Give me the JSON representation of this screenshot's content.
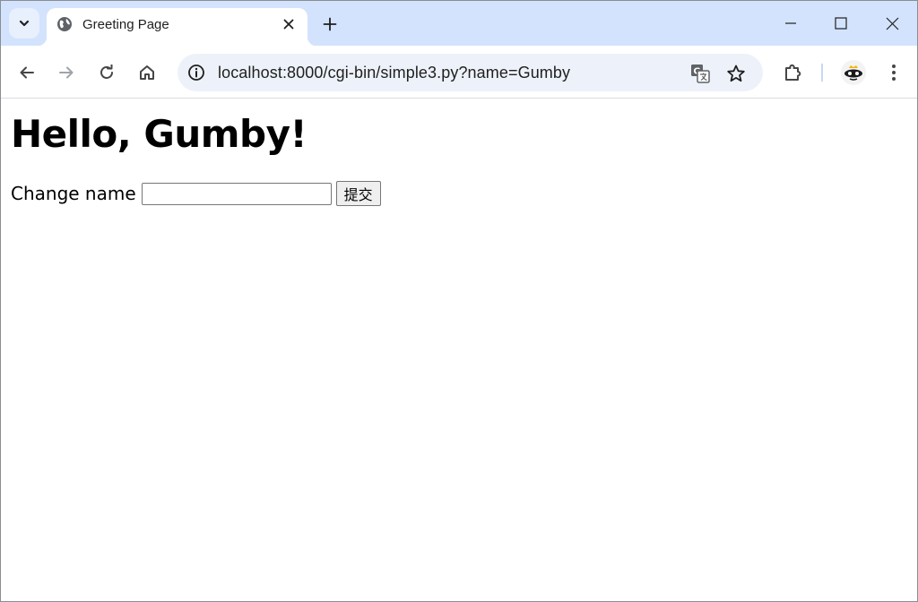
{
  "browser": {
    "tab": {
      "title": "Greeting Page"
    },
    "address_bar": {
      "url": "localhost:8000/cgi-bin/simple3.py?name=Gumby"
    }
  },
  "page": {
    "heading": "Hello, Gumby!",
    "form": {
      "label": "Change name",
      "input_value": "",
      "submit_label": "提交"
    }
  },
  "icons": {
    "tab_search": "chevron-down-icon",
    "favicon": "globe-icon",
    "tab_close": "close-icon",
    "new_tab": "plus-icon",
    "minimize": "minimize-icon",
    "maximize": "maximize-icon",
    "close_window": "close-icon",
    "back": "back-arrow-icon",
    "forward": "forward-arrow-icon",
    "reload": "reload-icon",
    "home": "home-icon",
    "site_info": "info-icon",
    "translate": "translate-icon",
    "bookmark": "star-icon",
    "extensions": "puzzle-icon",
    "menu": "kebab-menu-icon"
  },
  "colors": {
    "tabstrip": "#d3e3fd",
    "omnibox": "#edf2fa",
    "icon": "#444746"
  }
}
